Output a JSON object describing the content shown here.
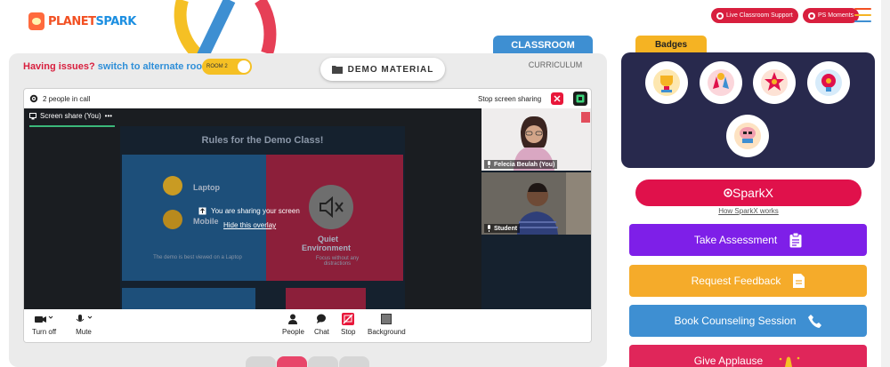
{
  "header": {
    "logo_text_a": "PLANET",
    "logo_text_b": "SPARK",
    "live_support": "Live Classroom Support",
    "ps_moments": "PS Moments",
    "hamburger_colors": [
      "#f25022",
      "#f5b323",
      "#3e8fd2"
    ]
  },
  "tabs": {
    "classroom": "CLASSROOM",
    "curriculum": "CURRICULUM"
  },
  "issues": {
    "text": "Having issues?",
    "link": "switch to alternate room",
    "room": "ROOM 2"
  },
  "demo_material": "DEMO MATERIAL",
  "call": {
    "people_count": "2 people in call",
    "stop_sharing": "Stop screen sharing",
    "screen_share_tab": "Screen share (You)",
    "tab_menu": "•••",
    "slide": {
      "title": "Rules for the Demo Class!",
      "laptop": "Laptop",
      "mobile": "Mobile",
      "quiet": "Quiet",
      "environment": "Environment",
      "focus_note": "Focus without any distractions",
      "laptop_note": "The demo is best viewed on a Laptop"
    },
    "overlay_msg": "You are sharing your screen",
    "overlay_link": "Hide this overlay",
    "participants": [
      {
        "name": "Felecia Beulah (You)"
      },
      {
        "name": "Student"
      }
    ],
    "toolbar": {
      "turn_off": "Turn off",
      "mute": "Mute",
      "people": "People",
      "chat": "Chat",
      "stop": "Stop",
      "background": "Background"
    }
  },
  "badges": {
    "title": "Badges",
    "items": [
      "trophy-badge-icon",
      "hands-badge-icon",
      "star-badge-icon",
      "idea-badge-icon",
      "brain-badge-icon"
    ]
  },
  "sparkx": {
    "label": "SparkX",
    "how": "How SparkX works"
  },
  "actions": [
    {
      "label": "Take Assessment",
      "color": "#7e1fe8"
    },
    {
      "label": "Request Feedback",
      "color": "#f5ab2a"
    },
    {
      "label": "Book Counseling Session",
      "color": "#3e8fd2"
    },
    {
      "label": "Give Applause",
      "color": "#e0265a"
    }
  ]
}
